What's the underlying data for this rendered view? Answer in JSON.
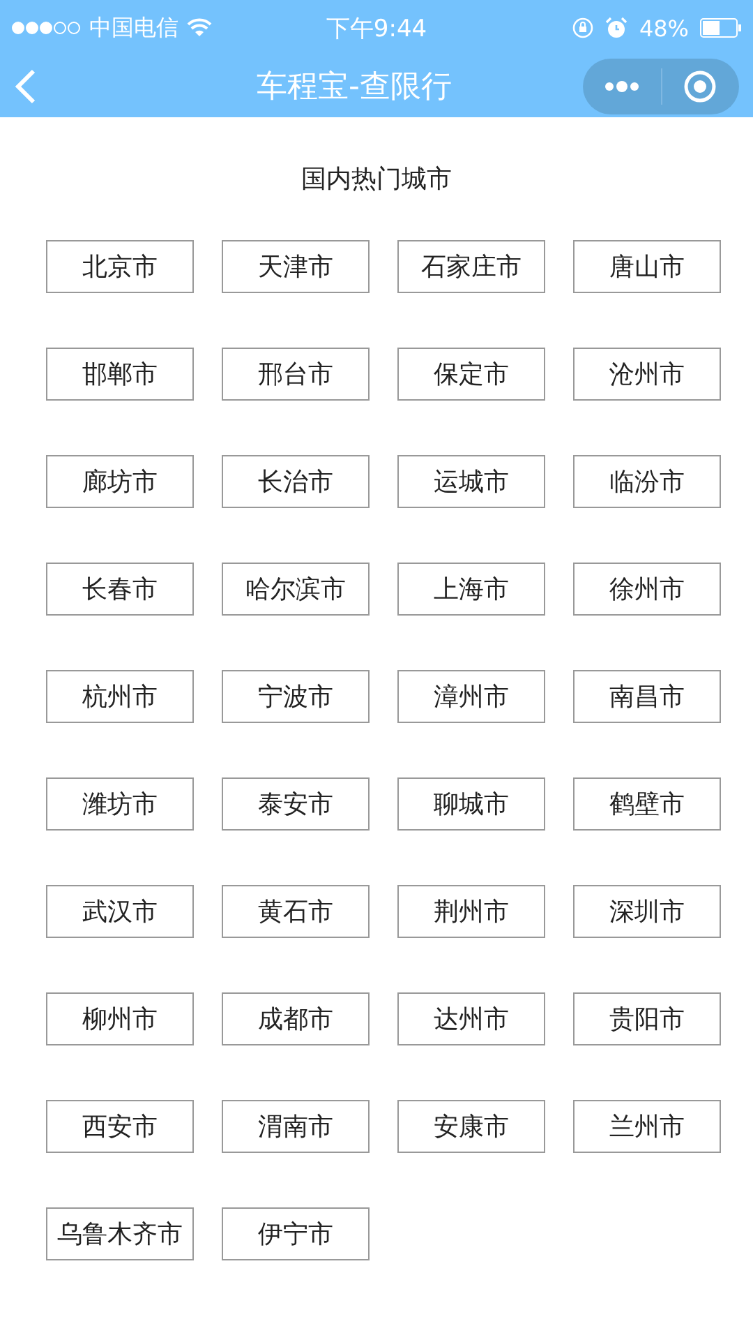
{
  "status_bar": {
    "carrier": "中国电信",
    "time": "下午9:44",
    "battery": "48%"
  },
  "nav_bar": {
    "title": "车程宝-查限行"
  },
  "section": {
    "title": "国内热门城市"
  },
  "cities": [
    "北京市",
    "天津市",
    "石家庄市",
    "唐山市",
    "邯郸市",
    "邢台市",
    "保定市",
    "沧州市",
    "廊坊市",
    "长治市",
    "运城市",
    "临汾市",
    "长春市",
    "哈尔滨市",
    "上海市",
    "徐州市",
    "杭州市",
    "宁波市",
    "漳州市",
    "南昌市",
    "潍坊市",
    "泰安市",
    "聊城市",
    "鹤壁市",
    "武汉市",
    "黄石市",
    "荆州市",
    "深圳市",
    "柳州市",
    "成都市",
    "达州市",
    "贵阳市",
    "西安市",
    "渭南市",
    "安康市",
    "兰州市",
    "乌鲁木齐市",
    "伊宁市"
  ]
}
